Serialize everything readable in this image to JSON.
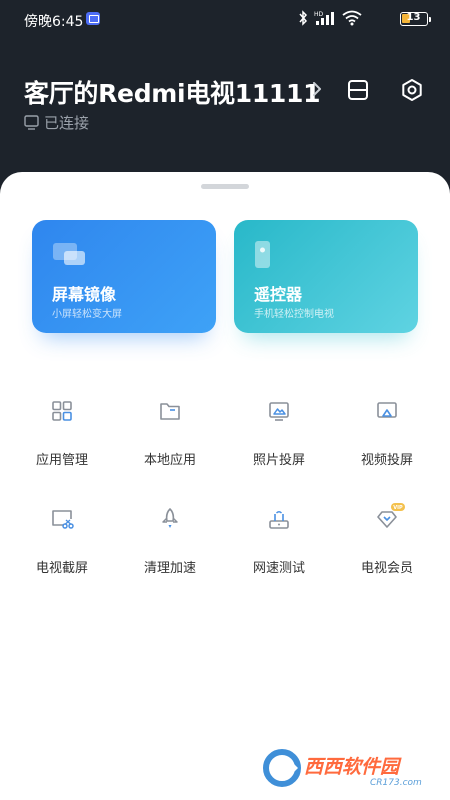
{
  "status_bar": {
    "time": "傍晚6:45",
    "battery": "13",
    "hd_label": "HD"
  },
  "header": {
    "device_name": "客厅的Redmi电视11111",
    "connection_status": "已连接"
  },
  "cards": [
    {
      "title": "屏幕镜像",
      "subtitle": "小屏轻松变大屏"
    },
    {
      "title": "遥控器",
      "subtitle": "手机轻松控制电视"
    }
  ],
  "tools": [
    {
      "label": "应用管理",
      "icon": "grid-apps-icon"
    },
    {
      "label": "本地应用",
      "icon": "folder-icon"
    },
    {
      "label": "照片投屏",
      "icon": "photo-cast-icon"
    },
    {
      "label": "视频投屏",
      "icon": "video-cast-icon"
    },
    {
      "label": "电视截屏",
      "icon": "screenshot-icon"
    },
    {
      "label": "清理加速",
      "icon": "rocket-icon"
    },
    {
      "label": "网速测试",
      "icon": "router-icon"
    },
    {
      "label": "电视会员",
      "icon": "vip-diamond-icon"
    }
  ],
  "vip_badge": "VIP",
  "watermark": {
    "text": "西西软件园",
    "sub": "CR173.com"
  },
  "colors": {
    "header_bg": "#1d232b",
    "mirror_card": "#2f86ee",
    "remote_card": "#28b8c9",
    "icon_blue": "#4a90e2",
    "battery": "#f3b43a"
  }
}
